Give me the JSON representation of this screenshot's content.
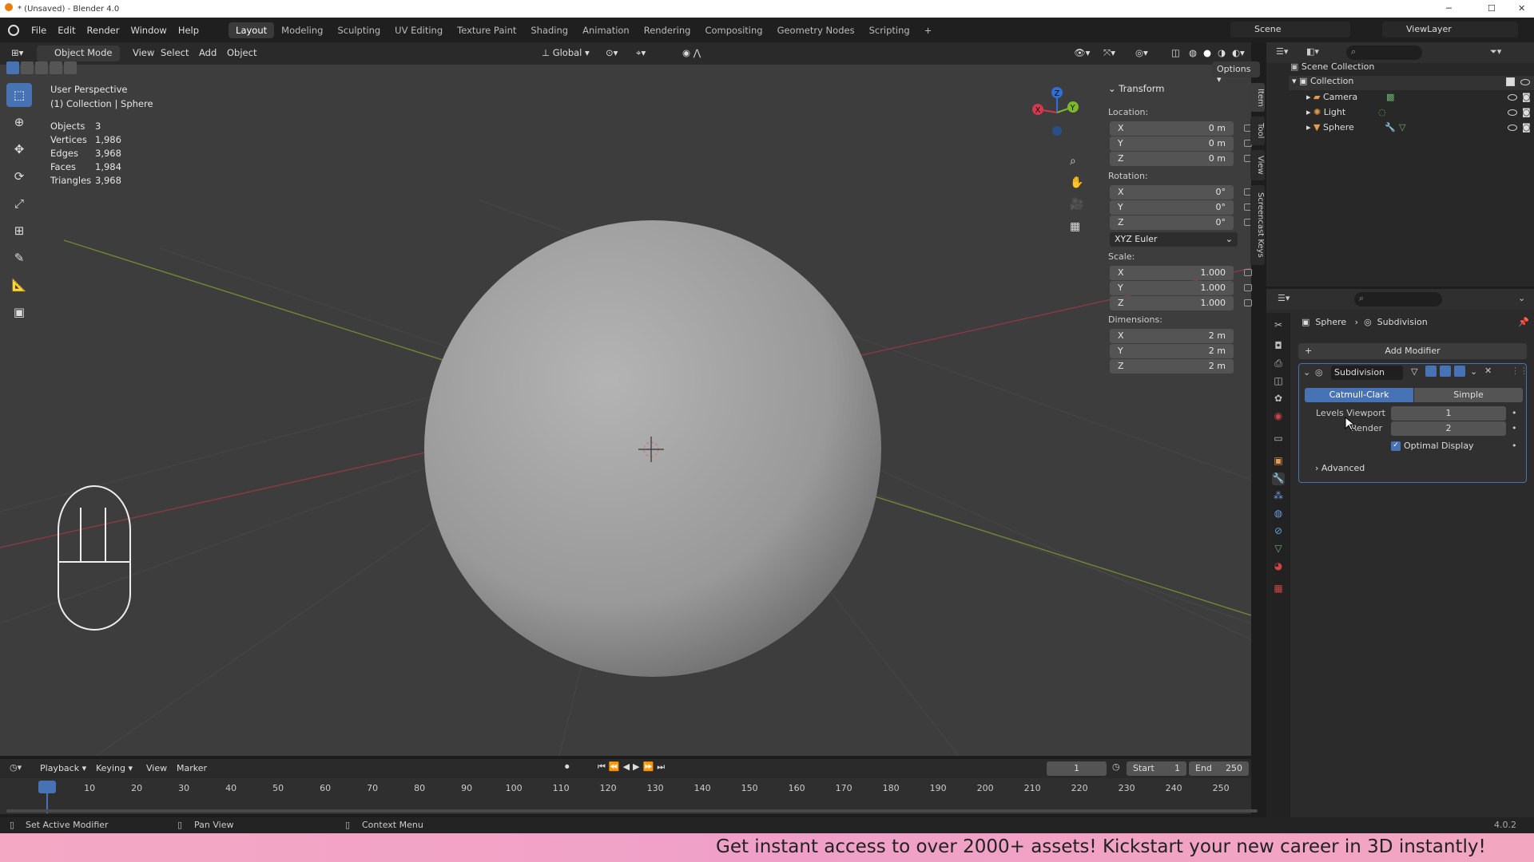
{
  "window": {
    "title": "* (Unsaved) - Blender 4.0"
  },
  "menu": [
    "File",
    "Edit",
    "Render",
    "Window",
    "Help"
  ],
  "workspaces": [
    "Layout",
    "Modeling",
    "Sculpting",
    "UV Editing",
    "Texture Paint",
    "Shading",
    "Animation",
    "Rendering",
    "Compositing",
    "Geometry Nodes",
    "Scripting",
    "+"
  ],
  "topright": {
    "scene": "Scene",
    "viewlayer": "ViewLayer"
  },
  "viewport_header": {
    "mode": "Object Mode",
    "view": "View",
    "select": "Select",
    "add": "Add",
    "object": "Object",
    "orientation": "Global",
    "options": "Options"
  },
  "overlay": {
    "perspective": "User Perspective",
    "context": "(1) Collection | Sphere",
    "stats": [
      {
        "label": "Objects",
        "value": "3"
      },
      {
        "label": "Vertices",
        "value": "1,986"
      },
      {
        "label": "Edges",
        "value": "3,968"
      },
      {
        "label": "Faces",
        "value": "1,984"
      },
      {
        "label": "Triangles",
        "value": "3,968"
      }
    ]
  },
  "gizmo": {
    "x": "X",
    "y": "Y",
    "z": "Z"
  },
  "transform": {
    "title": "Transform",
    "location_label": "Location:",
    "rotation_label": "Rotation:",
    "scale_label": "Scale:",
    "dimensions_label": "Dimensions:",
    "rotation_mode": "XYZ Euler",
    "location": [
      {
        "axis": "X",
        "value": "0 m"
      },
      {
        "axis": "Y",
        "value": "0 m"
      },
      {
        "axis": "Z",
        "value": "0 m"
      }
    ],
    "rotation": [
      {
        "axis": "X",
        "value": "0°"
      },
      {
        "axis": "Y",
        "value": "0°"
      },
      {
        "axis": "Z",
        "value": "0°"
      }
    ],
    "scale": [
      {
        "axis": "X",
        "value": "1.000"
      },
      {
        "axis": "Y",
        "value": "1.000"
      },
      {
        "axis": "Z",
        "value": "1.000"
      }
    ],
    "dimensions": [
      {
        "axis": "X",
        "value": "2 m"
      },
      {
        "axis": "Y",
        "value": "2 m"
      },
      {
        "axis": "Z",
        "value": "2 m"
      }
    ]
  },
  "sidetabs": [
    "Item",
    "Tool",
    "View",
    "Screencast Keys"
  ],
  "outliner": {
    "root": "Scene Collection",
    "collection": "Collection",
    "items": [
      "Camera",
      "Light",
      "Sphere"
    ]
  },
  "properties": {
    "breadcrumb_object": "Sphere",
    "breadcrumb_modifier": "Subdivision",
    "add_modifier": "Add Modifier",
    "modifier_name": "Subdivision",
    "tab_catmull": "Catmull-Clark",
    "tab_simple": "Simple",
    "levels_viewport_label": "Levels Viewport",
    "levels_viewport": "1",
    "render_label": "Render",
    "render": "2",
    "optimal_display": "Optimal Display",
    "advanced": "Advanced"
  },
  "timeline": {
    "playback": "Playback",
    "keying": "Keying",
    "view": "View",
    "marker": "Marker",
    "current_frame": "1",
    "start_label": "Start",
    "start": "1",
    "end_label": "End",
    "end": "250",
    "ticks": [
      "1",
      "10",
      "20",
      "30",
      "40",
      "50",
      "60",
      "70",
      "80",
      "90",
      "100",
      "110",
      "120",
      "130",
      "140",
      "150",
      "160",
      "170",
      "180",
      "190",
      "200",
      "210",
      "220",
      "230",
      "240",
      "250"
    ]
  },
  "statusbar": {
    "left": "Set Active Modifier",
    "middle": "Pan View",
    "right": "Context Menu",
    "version": "4.0.2"
  },
  "banner": {
    "text": "Get instant access to over 2000+ assets! Kickstart your new career in 3D instantly!"
  }
}
